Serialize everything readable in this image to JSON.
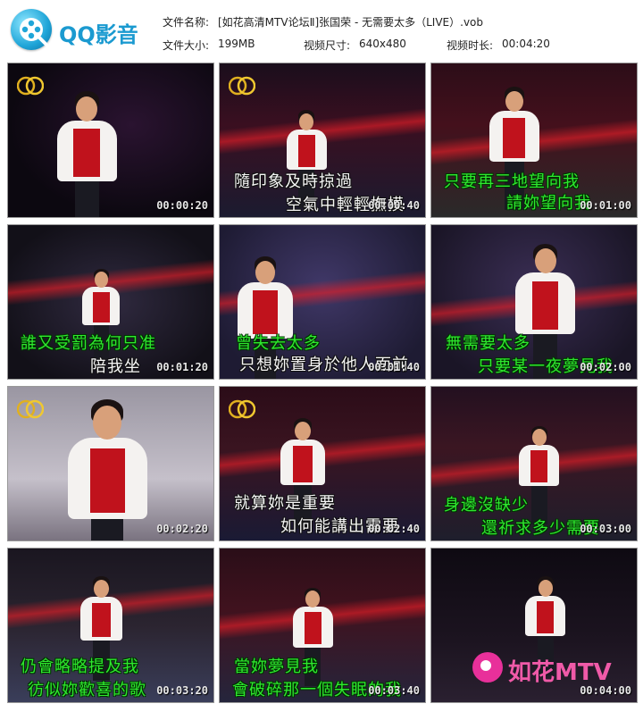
{
  "app": {
    "name": "QQ影音"
  },
  "file_info": {
    "name_label": "文件名称:",
    "name_value": "[如花高清MTV论坛Ⅱ]张国荣 - 无需要太多（LIVE）.vob",
    "size_label": "文件大小:",
    "size_value": "199MB",
    "dims_label": "视频尺寸:",
    "dims_value": "640x480",
    "duration_label": "视频时长:",
    "duration_value": "00:04:20"
  },
  "colors": {
    "subtitle_green": "#2fe82f",
    "subtitle_white": "#f6f6f6",
    "stage_red": "#c0121c",
    "brand_pink": "#f05aa8"
  },
  "thumbnails": [
    {
      "time": "00:00:20",
      "lines": []
    },
    {
      "time": "00:00:40",
      "lines": [
        "隨印象及時掠過",
        "空氣中輕輕撫摸"
      ]
    },
    {
      "time": "00:01:00",
      "lines": [
        "只要再三地望向我",
        "請妳望向我"
      ]
    },
    {
      "time": "00:01:20",
      "lines": [
        "誰又受罰為何只准",
        "陪我坐"
      ]
    },
    {
      "time": "00:01:40",
      "lines": [
        "曾失去太多",
        "只想妳置身於他人面前"
      ]
    },
    {
      "time": "00:02:00",
      "lines": [
        "無需要太多",
        "只要某一夜夢見我"
      ]
    },
    {
      "time": "00:02:20",
      "lines": []
    },
    {
      "time": "00:02:40",
      "lines": [
        "就算妳是重要",
        "如何能講出需要"
      ]
    },
    {
      "time": "00:03:00",
      "lines": [
        "身邊沒缺少",
        "還祈求多少需要"
      ]
    },
    {
      "time": "00:03:20",
      "lines": [
        "仍會略略提及我",
        "彷似妳歡喜的歌"
      ]
    },
    {
      "time": "00:03:40",
      "lines": [
        "當妳夢見我",
        "會破碎那一個失眠的我"
      ]
    },
    {
      "time": "00:04:00",
      "lines": []
    }
  ],
  "brand": {
    "text": "如花MTV"
  }
}
